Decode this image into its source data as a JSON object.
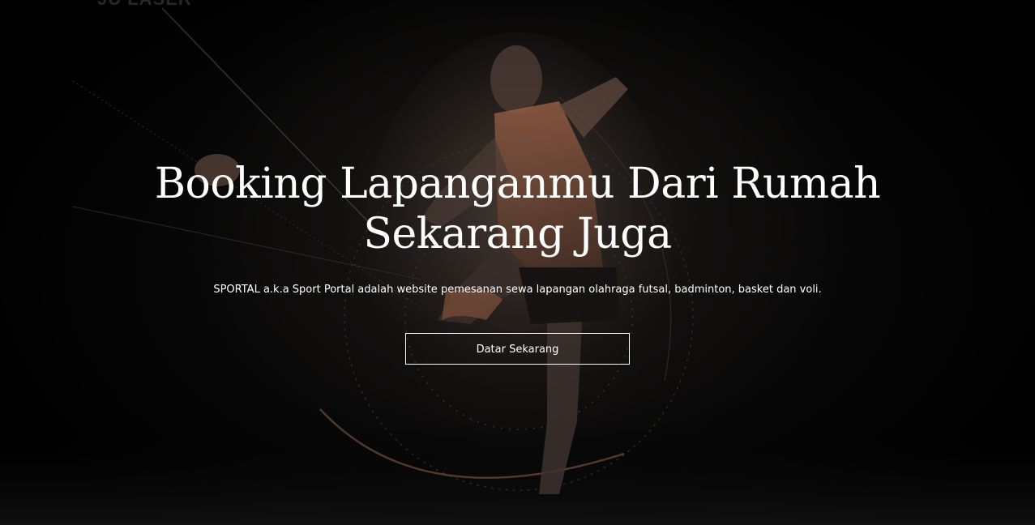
{
  "brand": {
    "watermark": "JU LASER"
  },
  "hero": {
    "headline_line1": "Booking Lapanganmu Dari Rumah",
    "headline_line2": "Sekarang Juga",
    "subtitle": "SPORTAL a.k.a Sport Portal adalah website pemesanan sewa lapangan olahraga futsal, badminton, basket dan voli.",
    "cta_label": "Datar Sekarang",
    "background_icon": "footballer-kicking-photo"
  },
  "colors": {
    "background": "#000000",
    "text": "#ffffff",
    "accent_jersey": "#c9825a",
    "button_border": "#ffffff"
  }
}
